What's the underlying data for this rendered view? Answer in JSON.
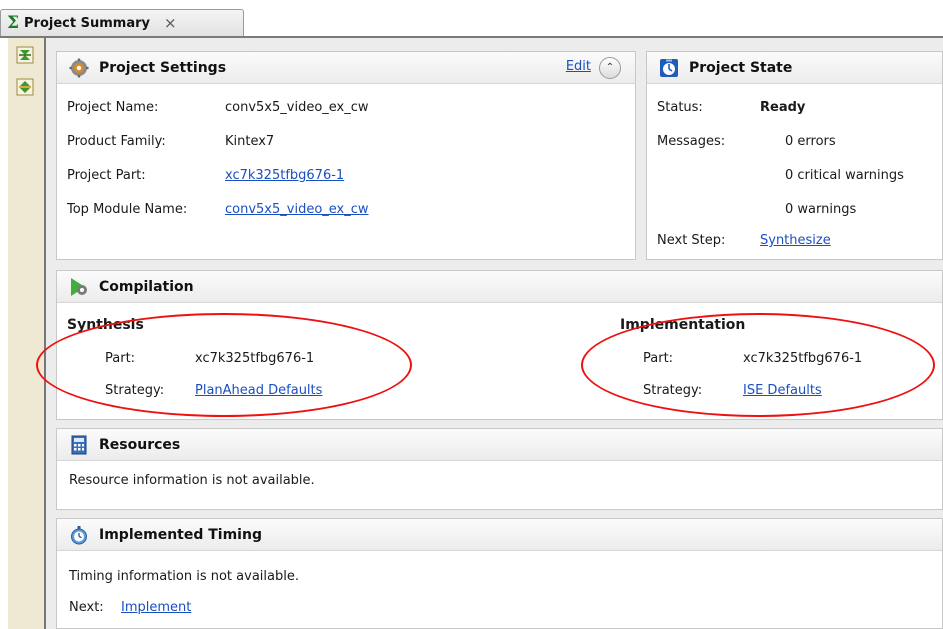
{
  "tab": {
    "title": "Project Summary",
    "close_symbol": "×"
  },
  "toolbar_icons": [
    "collapse-all-icon",
    "expand-all-icon"
  ],
  "project_settings": {
    "title": "Project Settings",
    "edit_label": "Edit",
    "collapse_symbol": "⌃",
    "fields": {
      "name_label": "Project Name:",
      "name_value": "conv5x5_video_ex_cw",
      "family_label": "Product Family:",
      "family_value": "Kintex7",
      "part_label": "Project Part:",
      "part_value": "xc7k325tfbg676-1",
      "top_label": "Top Module Name:",
      "top_value": "conv5x5_video_ex_cw"
    }
  },
  "project_state": {
    "title": "Project State",
    "status_label": "Status:",
    "status_value": "Ready",
    "messages_label": "Messages:",
    "errors": "0 errors",
    "critical_warnings": "0 critical warnings",
    "warnings": "0 warnings",
    "next_step_label": "Next Step:",
    "next_step_value": "Synthesize"
  },
  "compilation": {
    "title": "Compilation",
    "synthesis": {
      "heading": "Synthesis",
      "part_label": "Part:",
      "part_value": "xc7k325tfbg676-1",
      "strategy_label": "Strategy:",
      "strategy_value": "PlanAhead Defaults"
    },
    "implementation": {
      "heading": "Implementation",
      "part_label": "Part:",
      "part_value": "xc7k325tfbg676-1",
      "strategy_label": "Strategy:",
      "strategy_value": "ISE Defaults"
    }
  },
  "resources": {
    "title": "Resources",
    "message": "Resource information is not available."
  },
  "timing": {
    "title": "Implemented Timing",
    "message": "Timing information is not available.",
    "next_label": "Next:",
    "next_value": "Implement"
  },
  "colors": {
    "link": "#1a4fc4",
    "annotation": "#ee1111",
    "toolbar_bg": "#efe9d3"
  }
}
